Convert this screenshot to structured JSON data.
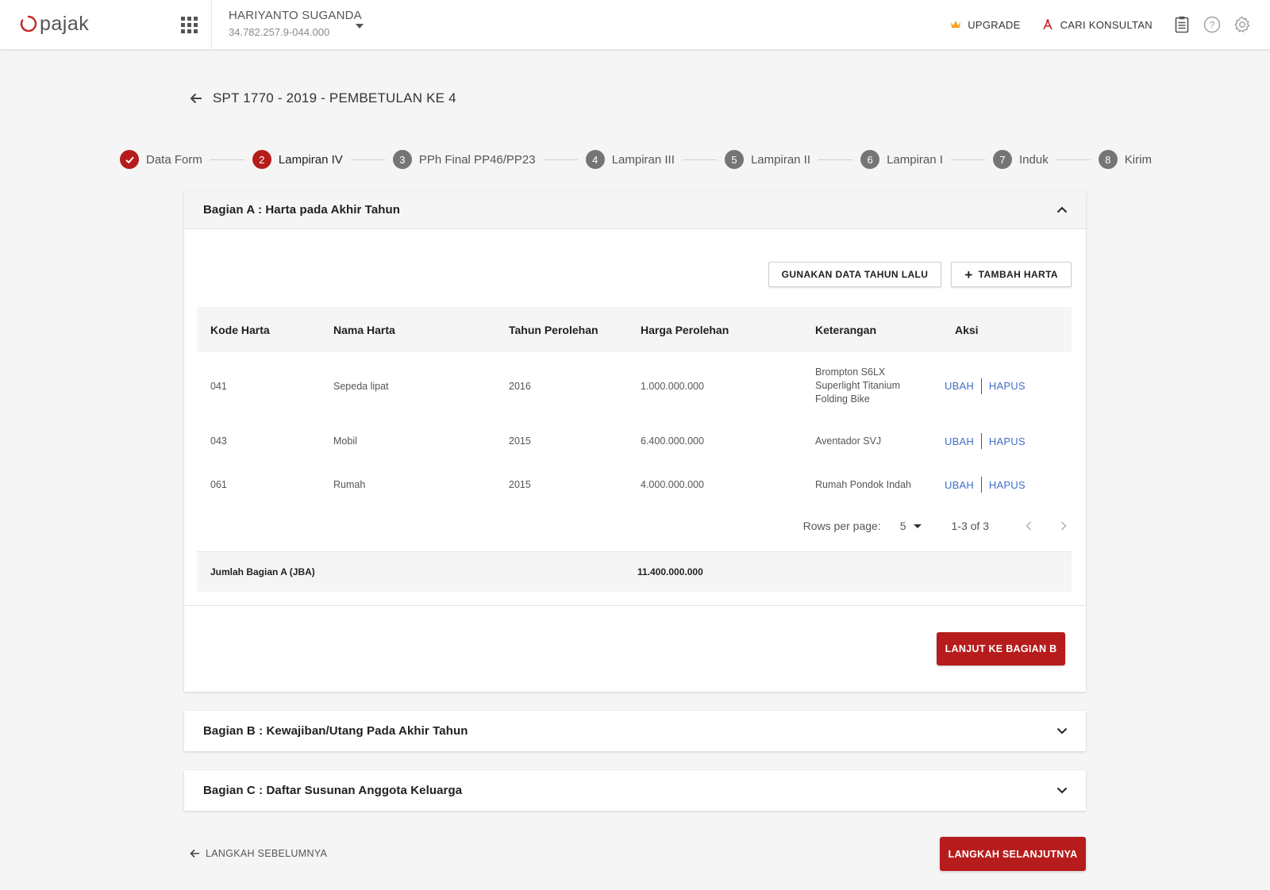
{
  "app": {
    "logo_text": "pajak"
  },
  "account": {
    "name": "HARIYANTO SUGANDA",
    "npwp": "34.782.257.9-044.000"
  },
  "topbar": {
    "upgrade_label": "UPGRADE",
    "consultant_label": "CARI KONSULTAN"
  },
  "page": {
    "title": "SPT 1770 - 2019 - PEMBETULAN KE 4"
  },
  "stepper": {
    "steps": [
      {
        "num": "",
        "label": "Data Form",
        "state": "done"
      },
      {
        "num": "2",
        "label": "Lampiran IV",
        "state": "active"
      },
      {
        "num": "3",
        "label": "PPh Final PP46/PP23",
        "state": "pending"
      },
      {
        "num": "4",
        "label": "Lampiran III",
        "state": "pending"
      },
      {
        "num": "5",
        "label": "Lampiran II",
        "state": "pending"
      },
      {
        "num": "6",
        "label": "Lampiran I",
        "state": "pending"
      },
      {
        "num": "7",
        "label": "Induk",
        "state": "pending"
      },
      {
        "num": "8",
        "label": "Kirim",
        "state": "pending"
      }
    ]
  },
  "section_a": {
    "title": "Bagian A : Harta pada Akhir Tahun",
    "btn_last_year": "GUNAKAN DATA TAHUN LALU",
    "btn_add": "TAMBAH HARTA",
    "columns": [
      "Kode Harta",
      "Nama Harta",
      "Tahun Perolehan",
      "Harga Perolehan",
      "Keterangan",
      "Aksi"
    ],
    "rows": [
      {
        "kode": "041",
        "nama": "Sepeda lipat",
        "tahun": "2016",
        "harga": "1.000.000.000",
        "keterangan": [
          "Brompton S6LX",
          "Superlight Titanium",
          "Folding Bike"
        ],
        "ubah": "UBAH",
        "hapus": "HAPUS"
      },
      {
        "kode": "043",
        "nama": "Mobil",
        "tahun": "2015",
        "harga": "6.400.000.000",
        "keterangan": [
          "Aventador SVJ"
        ],
        "ubah": "UBAH",
        "hapus": "HAPUS"
      },
      {
        "kode": "061",
        "nama": "Rumah",
        "tahun": "2015",
        "harga": "4.000.000.000",
        "keterangan": [
          "Rumah Pondok Indah"
        ],
        "ubah": "UBAH",
        "hapus": "HAPUS"
      }
    ],
    "pagination": {
      "rows_per_page_label": "Rows per page:",
      "rows_per_page": "5",
      "range": "1-3 of 3"
    },
    "total_label": "Jumlah Bagian A (JBA)",
    "total_value": "11.400.000.000",
    "btn_next_section": "LANJUT KE BAGIAN B"
  },
  "section_b": {
    "title": "Bagian B : Kewajiban/Utang Pada Akhir Tahun"
  },
  "section_c": {
    "title": "Bagian C : Daftar Susunan Anggota Keluarga"
  },
  "footer": {
    "prev_label": "LANGKAH SEBELUMNYA",
    "next_label": "LANGKAH SELANJUTNYA"
  },
  "colors": {
    "brand": "#b71c1c",
    "link": "#3f6fc8",
    "step_pending": "#757575",
    "upgrade_icon": "#f5a623"
  }
}
